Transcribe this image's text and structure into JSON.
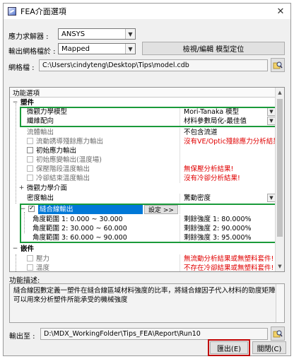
{
  "window": {
    "title": "FEA介面選項"
  },
  "solver": {
    "label": "應力求解器 :",
    "value": "ANSYS"
  },
  "mesh": {
    "label": "輸出網格檔於 :",
    "value": "Mapped",
    "button_label": "檢視/編輯 模型定位"
  },
  "mesh_file": {
    "label": "網格檔 :",
    "path": "C:\\Users\\cindyteng\\Desktop\\Tips\\model.cdb"
  },
  "options": {
    "header": "功能選項",
    "rows": [
      {
        "col1": "塑件",
        "col2": ""
      },
      {
        "col1": "微觀力學模型",
        "col2": "Mori-Tanaka 模型"
      },
      {
        "col1": "纖維配向",
        "col2": "材料參數局化-最佳值"
      },
      {
        "col1": "流體輸出",
        "col2": "不包含流道"
      },
      {
        "col1": "流動誘導殘餘應力輸出",
        "col2": "沒有VE/Optic殘餘應力分析結果!"
      },
      {
        "col1": "初始應力輸出",
        "col2": ""
      },
      {
        "col1": "初始應變輸出(溫度場)",
        "col2": ""
      },
      {
        "col1": "保壓階段溫度輸出",
        "col2": "無保壓分析結果!"
      },
      {
        "col1": "冷卻結束溫度輸出",
        "col2": "沒有冷卻分析結果!"
      },
      {
        "col1": "微觀力學介面",
        "col2": ""
      },
      {
        "col1": "密度輸出",
        "col2": "驚動密度"
      },
      {
        "col1": "縫合線輸出",
        "col2": "",
        "button": "設定 >>"
      },
      {
        "col1": "角度範圍 1:  0.000 ~ 30.000",
        "col2": "剩餘強度 1: 80.000%"
      },
      {
        "col1": "角度範圍 2: 30.000 ~ 60.000",
        "col2": "剩餘強度 2: 90.000%"
      },
      {
        "col1": "角度範圍 3: 60.000 ~ 90.000",
        "col2": "剩餘強度 3: 95.000%"
      },
      {
        "col1": "嵌件",
        "col2": ""
      },
      {
        "col1": "壓力",
        "col2": "無流動分析結果或無塑料套件!"
      },
      {
        "col1": "溫度",
        "col2": "不存在冷卻結果或無塑料套件!"
      }
    ]
  },
  "description": {
    "label": "功能描述:",
    "text": "縫合線因數定義一塑件在縫合線區域材料強度的比率，將縫合線因子代入材料的勁度矩陣可以用來分析塑件所能承受的機械強度"
  },
  "output": {
    "label": "輸出至 :",
    "path": "D:\\MDX_WorkingFolder\\Tips_FEA\\Report\\Run10"
  },
  "buttons": {
    "export": "匯出(E)",
    "close": "關閉(C)"
  },
  "colors": {
    "highlight_green": "#1a9a3a",
    "highlight_red": "#c00000",
    "selection_blue": "#0078d7",
    "warning_red": "#e00000"
  }
}
